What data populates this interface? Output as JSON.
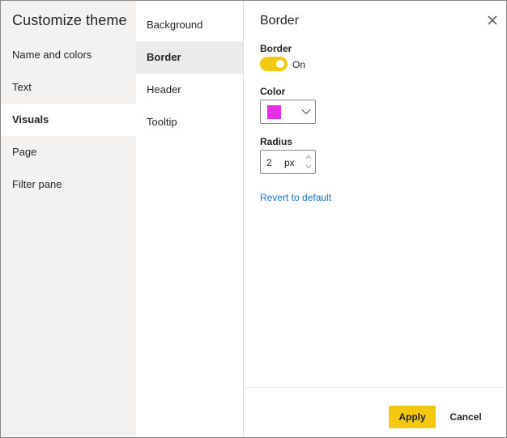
{
  "dialog": {
    "title": "Customize theme"
  },
  "categories": [
    {
      "label": "Name and colors",
      "selected": false
    },
    {
      "label": "Text",
      "selected": false
    },
    {
      "label": "Visuals",
      "selected": true
    },
    {
      "label": "Page",
      "selected": false
    },
    {
      "label": "Filter pane",
      "selected": false
    }
  ],
  "subcategories": [
    {
      "label": "Background",
      "selected": false
    },
    {
      "label": "Border",
      "selected": true
    },
    {
      "label": "Header",
      "selected": false
    },
    {
      "label": "Tooltip",
      "selected": false
    }
  ],
  "settings": {
    "title": "Border",
    "border": {
      "label": "Border",
      "state_text": "On",
      "on": true
    },
    "color": {
      "label": "Color",
      "value": "#e62ee6"
    },
    "radius": {
      "label": "Radius",
      "value": "2",
      "unit": "px"
    },
    "revert_label": "Revert to default"
  },
  "footer": {
    "apply_label": "Apply",
    "cancel_label": "Cancel"
  },
  "icons": {
    "close": "close-icon",
    "chevron": "chevron-down-icon",
    "spin_up": "spin-up-icon",
    "spin_down": "spin-down-icon"
  },
  "colors": {
    "accent": "#f2c811",
    "link": "#1a73c8",
    "left_pane_bg": "#f3f2f1",
    "selected_sub_bg": "#edebe9"
  }
}
